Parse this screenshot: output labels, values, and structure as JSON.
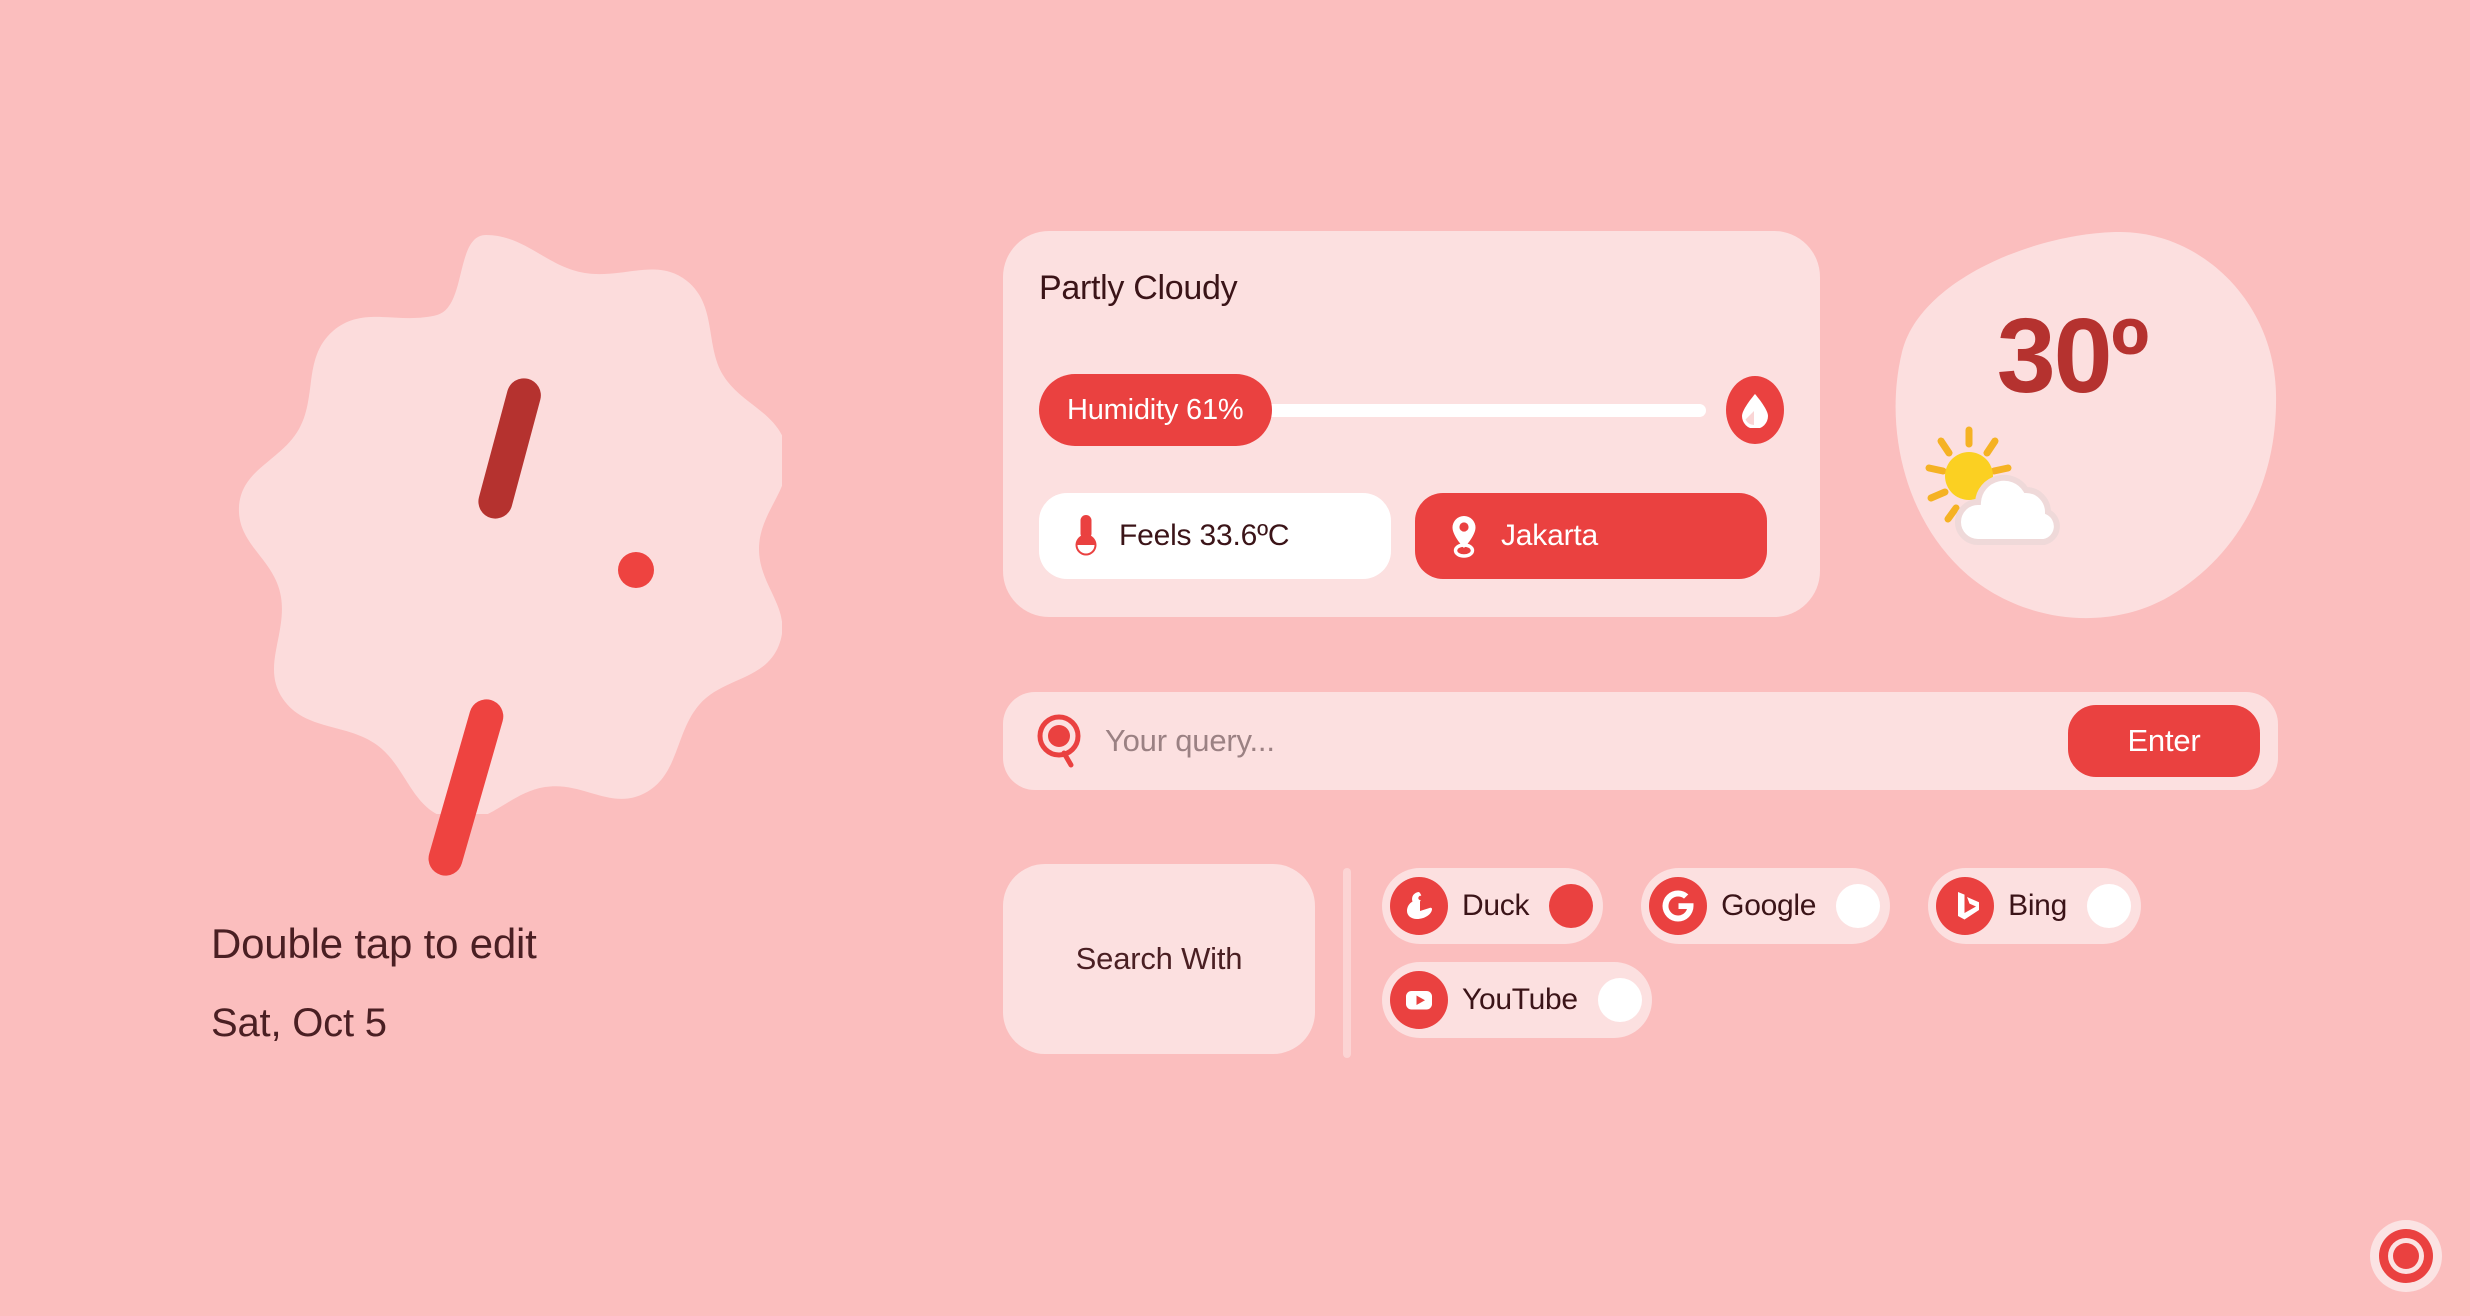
{
  "theme": {
    "background": "#FBBEBE",
    "card_surface": "#FCE0E0",
    "accent_red": "#EA4140",
    "deep_red": "#B5322F",
    "text_dark": "#3B1418",
    "white": "#FFFFFF"
  },
  "clock": {
    "widget_name": "analog-clock",
    "title": "Double tap to edit",
    "date": "Sat, Oct 5",
    "hour_hand_deg": 15,
    "minute_hand_deg": 196
  },
  "weather": {
    "condition": "Partly Cloudy",
    "humidity_label": "Humidity 61%",
    "humidity_percent": 61,
    "droplet_icon": "water-drop-icon",
    "feels_like": "Feels 33.6ºC",
    "thermometer_icon": "thermometer-icon",
    "location": "Jakarta",
    "location_icon": "map-pin-icon",
    "temperature": "30º",
    "weather_icon": "sun-behind-cloud-icon"
  },
  "search": {
    "icon": "magnifier-icon",
    "placeholder": "Your query...",
    "value": "",
    "enter_label": "Enter"
  },
  "search_with": {
    "label": "Search With",
    "engines": [
      {
        "name": "Duck",
        "icon": "duckduckgo-icon",
        "selected": true
      },
      {
        "name": "Google",
        "icon": "google-g-icon",
        "selected": false
      },
      {
        "name": "Bing",
        "icon": "bing-icon",
        "selected": false
      },
      {
        "name": "YouTube",
        "icon": "youtube-icon",
        "selected": false
      }
    ]
  },
  "record_button": {
    "icon": "record-target-icon"
  }
}
